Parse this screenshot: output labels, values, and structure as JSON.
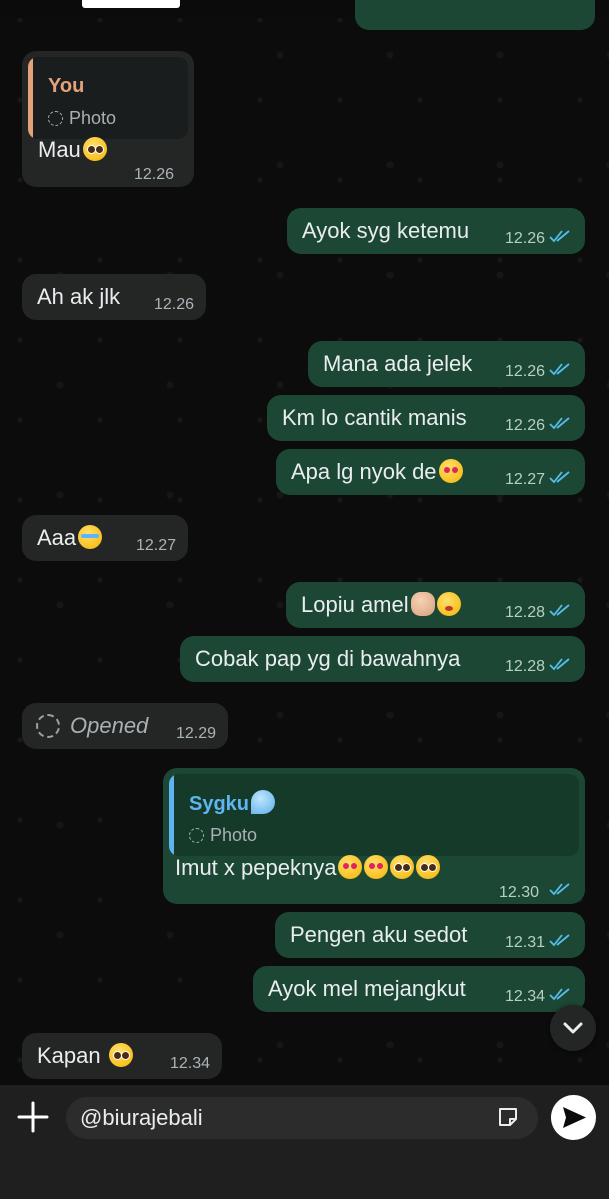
{
  "messages": [
    {
      "id": "m1",
      "dir": "in",
      "text": "Mau",
      "emoji": [
        "plead"
      ],
      "time": "12.26",
      "quote": {
        "name": "You",
        "sub": "Photo",
        "color": "#e3a27c"
      }
    },
    {
      "id": "m2",
      "dir": "out",
      "text": "Ayok syg ketemu",
      "emoji": [],
      "time": "12.26"
    },
    {
      "id": "m3",
      "dir": "in",
      "text": "Ah ak jlk",
      "emoji": [],
      "time": "12.26"
    },
    {
      "id": "m4",
      "dir": "out",
      "text": "Mana ada jelek",
      "emoji": [],
      "time": "12.26"
    },
    {
      "id": "m5",
      "dir": "out",
      "text": "Km lo cantik manis",
      "emoji": [],
      "time": "12.26"
    },
    {
      "id": "m6",
      "dir": "out",
      "text": "Apa lg nyok de",
      "emoji": [
        "heart"
      ],
      "time": "12.27"
    },
    {
      "id": "m7",
      "dir": "in",
      "text": "Aaa",
      "emoji": [
        "cry"
      ],
      "time": "12.27"
    },
    {
      "id": "m8",
      "dir": "out",
      "text": "Lopiu amel",
      "emoji": [
        "hand",
        "kiss"
      ],
      "time": "12.28"
    },
    {
      "id": "m9",
      "dir": "out",
      "text": "Cobak pap yg di bawahnya",
      "emoji": [],
      "time": "12.28"
    },
    {
      "id": "m10",
      "dir": "in",
      "text": "Opened",
      "emoji": [],
      "time": "12.29",
      "viewonce": true
    },
    {
      "id": "m11",
      "dir": "out",
      "text": "Imut x pepeknya",
      "emoji": [
        "heart",
        "heart",
        "plead",
        "plead"
      ],
      "time": "12.30",
      "quote": {
        "name": "Sygku",
        "sub": "Photo",
        "color": "#5fb5f2",
        "name_emoji": "drop"
      }
    },
    {
      "id": "m12",
      "dir": "out",
      "text": "Pengen aku sedot",
      "emoji": [],
      "time": "12.31"
    },
    {
      "id": "m13",
      "dir": "out",
      "text": "Ayok mel mejangkut",
      "emoji": [],
      "time": "12.34"
    },
    {
      "id": "m14",
      "dir": "in",
      "text": "Kapan ",
      "emoji": [
        "plead"
      ],
      "time": "12.34"
    }
  ],
  "composer": {
    "value": "@biurajebali"
  },
  "icons": {
    "tick": "double-check-icon",
    "scroll": "chevron-down-icon",
    "attach": "plus-icon",
    "sticker": "sticker-icon",
    "send": "send-icon",
    "viewonce": "view-once-icon"
  },
  "colors": {
    "outgoing": "#1c4734",
    "incoming": "#242626",
    "tick": "#53bdeb",
    "background": "#0b0b0b"
  }
}
